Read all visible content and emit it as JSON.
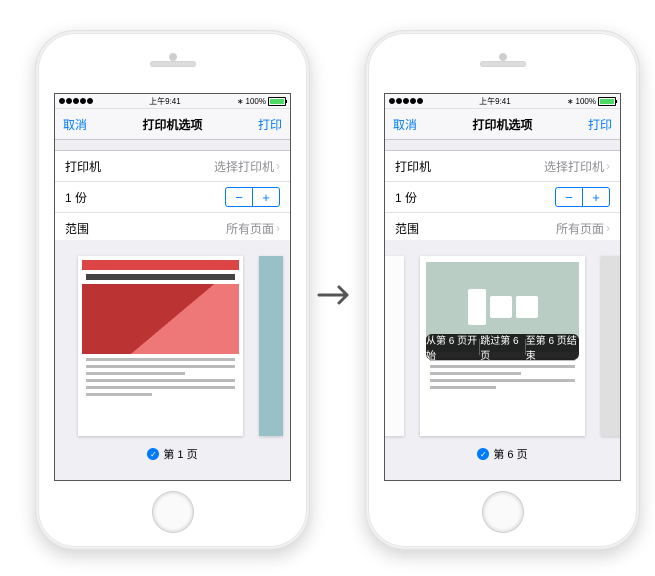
{
  "statusbar": {
    "time": "上午9:41",
    "battery": "100%",
    "bt_icon": "⚡"
  },
  "navbar": {
    "cancel": "取消",
    "title": "打印机选项",
    "print": "打印"
  },
  "rows": {
    "printer_label": "打印机",
    "printer_value": "选择打印机",
    "copies_label": "1 份",
    "range_label": "范围",
    "range_value": "所有页面"
  },
  "left": {
    "page_text": "第 1 页"
  },
  "right": {
    "page_text": "第 6 页",
    "menu": {
      "a": "从第 6 页开始",
      "b": "跳过第 6 页",
      "c": "至第 6 页结束"
    }
  }
}
